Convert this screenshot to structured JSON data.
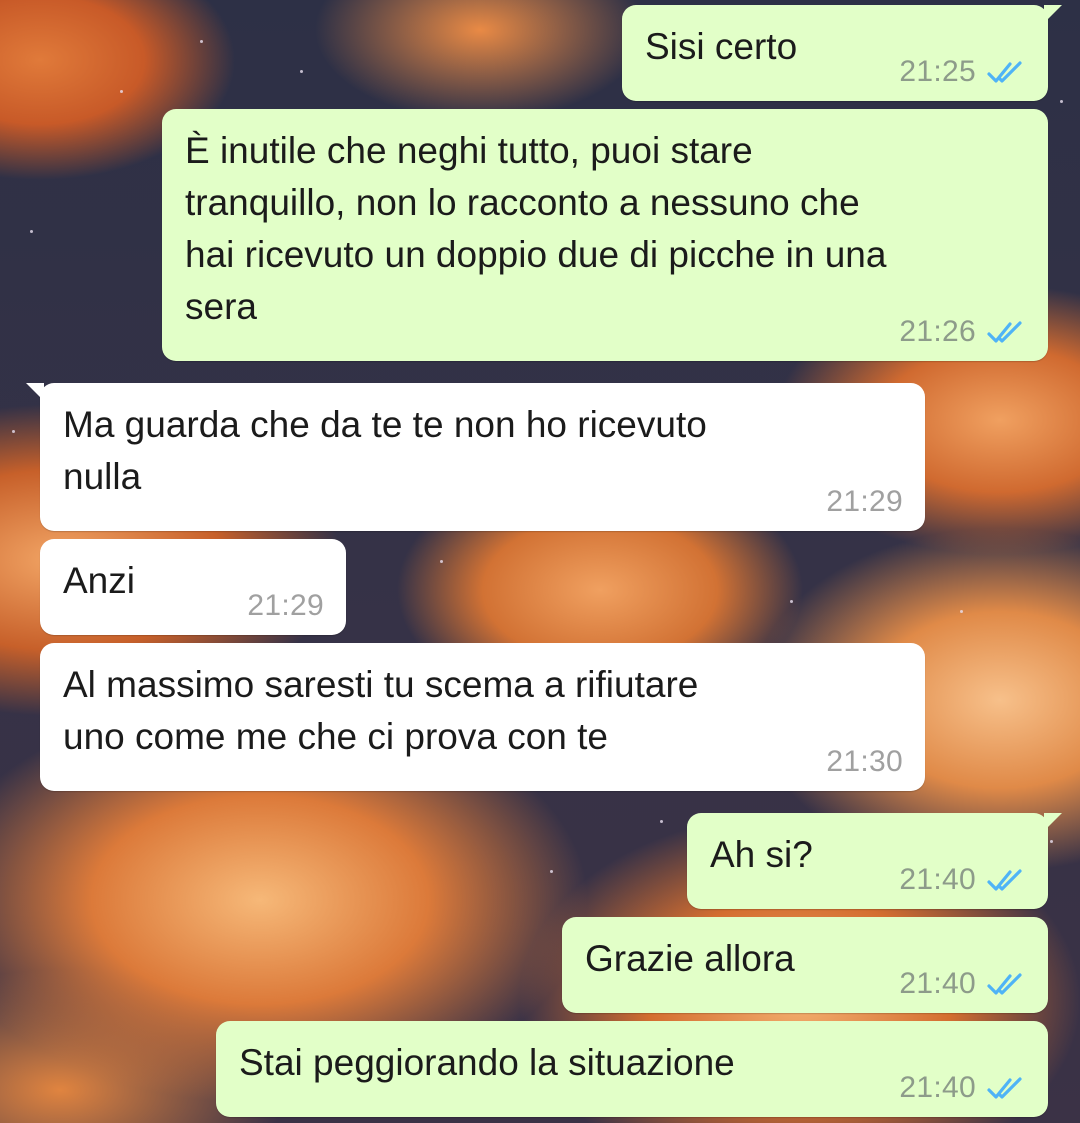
{
  "accent": {
    "outgoing_bubble": "#e2ffc8",
    "incoming_bubble": "#ffffff",
    "read_ticks": "#4fb3f6"
  },
  "messages": [
    {
      "direction": "outgoing",
      "text": "Sisi certo",
      "time": "21:25",
      "status_icon": "double-check-read-icon"
    },
    {
      "direction": "outgoing",
      "text": "È inutile che neghi tutto, puoi stare\ntranquillo, non lo racconto a nessuno che\nhai ricevuto un doppio due di picche in una\nsera",
      "time": "21:26",
      "status_icon": "double-check-read-icon"
    },
    {
      "direction": "incoming",
      "text": "Ma guarda che da te te non ho ricevuto\nnulla",
      "time": "21:29"
    },
    {
      "direction": "incoming",
      "text": "Anzi",
      "time": "21:29"
    },
    {
      "direction": "incoming",
      "text": "Al massimo saresti tu scema a rifiutare\nuno come me che ci prova con te",
      "time": "21:30"
    },
    {
      "direction": "outgoing",
      "text": "Ah si?",
      "time": "21:40",
      "status_icon": "double-check-read-icon"
    },
    {
      "direction": "outgoing",
      "text": "Grazie allora",
      "time": "21:40",
      "status_icon": "double-check-read-icon"
    },
    {
      "direction": "outgoing",
      "text": "Stai peggiorando la situazione",
      "time": "21:40",
      "status_icon": "double-check-read-icon"
    }
  ]
}
